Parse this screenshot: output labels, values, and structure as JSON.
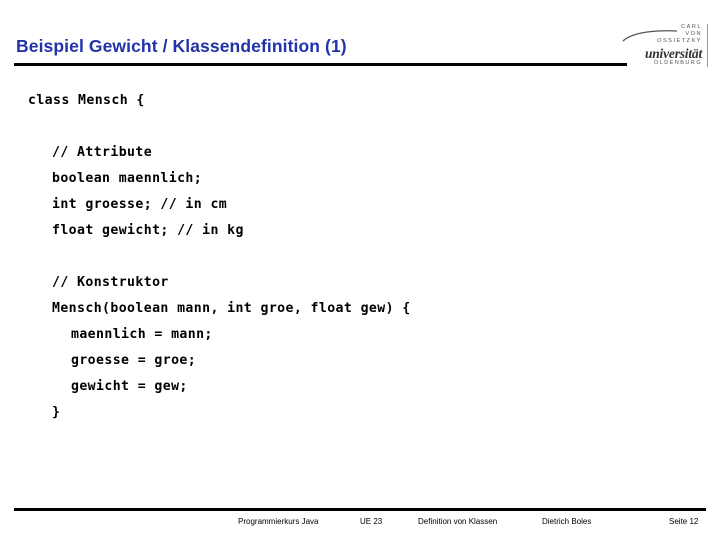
{
  "slide": {
    "title": "Beispiel Gewicht / Klassendefinition (1)",
    "accent_color": "#2233aa",
    "rule_color": "#000000",
    "background_color": "#ffffff"
  },
  "logo": {
    "line1": "CARL",
    "line2": "VON",
    "line3": "OSSIETZKY",
    "wordmark": "universität",
    "city": "OLDENBURG"
  },
  "code": {
    "lines": [
      {
        "indent": 0,
        "text": "class Mensch {"
      },
      {
        "indent": 0,
        "text": ""
      },
      {
        "indent": 1,
        "text": "// Attribute"
      },
      {
        "indent": 1,
        "text": "boolean maennlich;"
      },
      {
        "indent": 1,
        "text": "int groesse; // in cm"
      },
      {
        "indent": 1,
        "text": "float gewicht; // in kg"
      },
      {
        "indent": 0,
        "text": ""
      },
      {
        "indent": 1,
        "text": "// Konstruktor"
      },
      {
        "indent": 1,
        "text": "Mensch(boolean mann, int groe, float gew) {"
      },
      {
        "indent": 2,
        "text": "maennlich = mann;"
      },
      {
        "indent": 2,
        "text": "groesse = groe;"
      },
      {
        "indent": 2,
        "text": "gewicht = gew;"
      },
      {
        "indent": 1,
        "text": "}"
      }
    ]
  },
  "footer": {
    "course": "Programmierkurs Java",
    "unit": "UE 23",
    "topic": "Definition von Klassen",
    "author": "Dietrich Boles",
    "page": "Seite 12"
  }
}
